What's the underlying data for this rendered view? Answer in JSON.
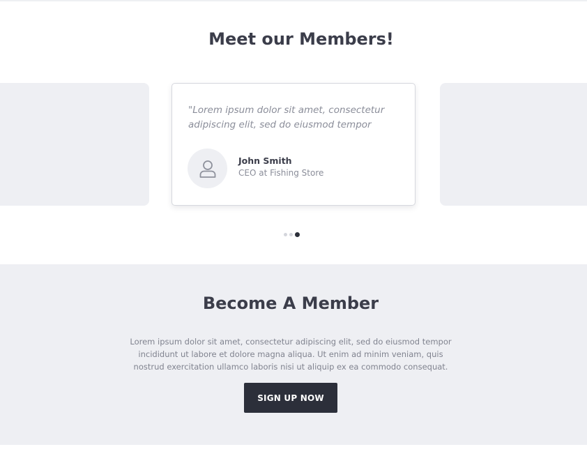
{
  "members": {
    "title": "Meet our Members!",
    "testimonial": {
      "quote": "\"Lorem ipsum dolor sit amet, consectetur adipiscing elit, sed do eiusmod tempor",
      "name": "John Smith",
      "role": "CEO at Fishing Store",
      "avatar_icon": "user-icon"
    },
    "carousel": {
      "dot_count": 3,
      "active_index": 2
    }
  },
  "become": {
    "title": "Become A Member",
    "text": "Lorem ipsum dolor sit amet, consectetur adipiscing elit, sed do eiusmod tempor incididunt ut labore et dolore magna aliqua. Ut enim ad minim veniam, quis nostrud exercitation ullamco laboris nisi ut aliquip ex ea commodo consequat.",
    "button_label": "SIGN UP NOW"
  },
  "colors": {
    "dark": "#2c2f3a",
    "heading": "#3b3d4a",
    "muted_text": "#8a8d99",
    "section_bg": "#eeeff3",
    "dot_inactive": "#d4d6dc"
  }
}
